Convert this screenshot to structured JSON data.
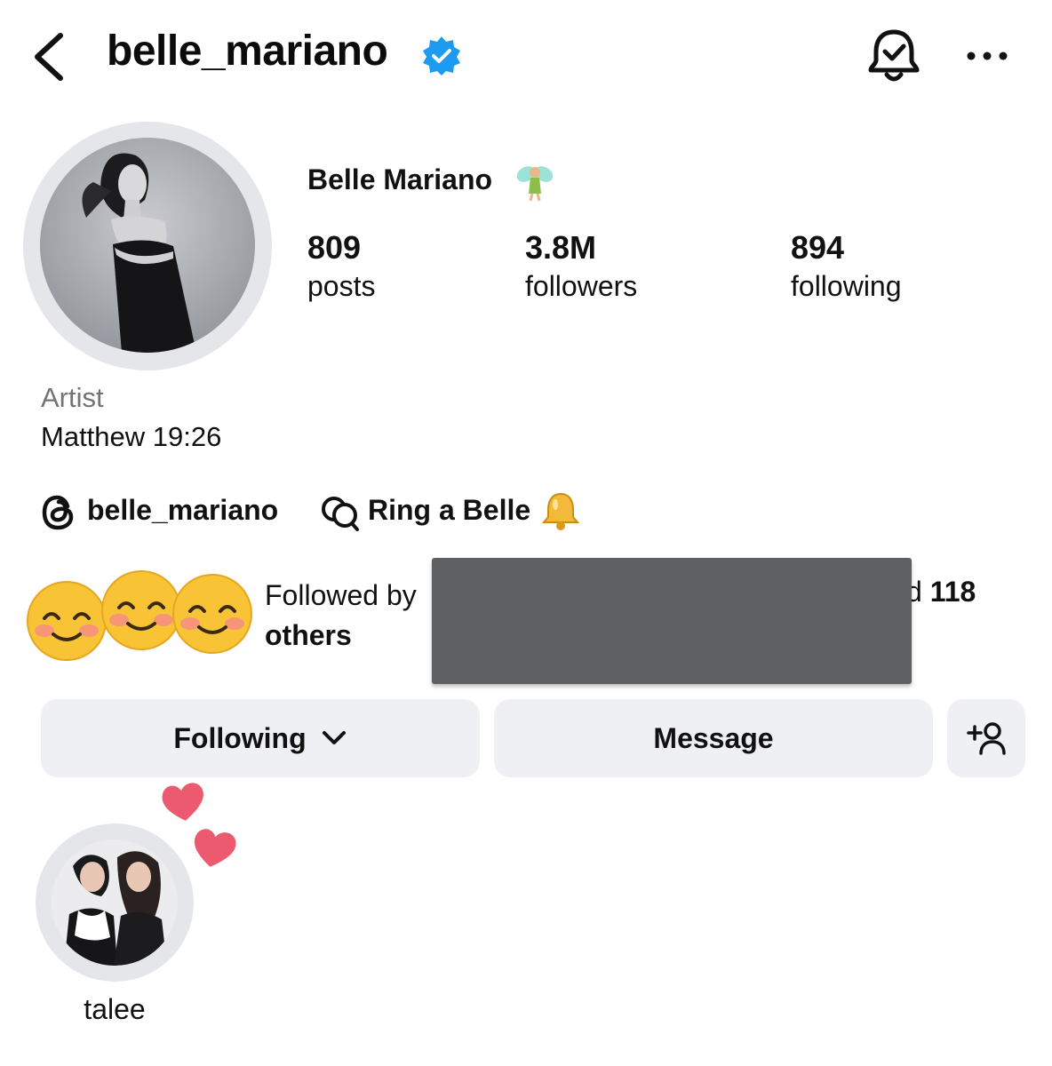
{
  "header": {
    "username": "belle_mariano",
    "back_icon": "chevron-left-icon",
    "verified_icon": "verified-badge-icon",
    "notifications_icon": "bell-check-icon",
    "more_icon": "more-horizontal-icon",
    "verified_color": "#1d9bf0"
  },
  "profile": {
    "full_name": "Belle Mariano",
    "name_emoji": "fairy-emoji",
    "stats": {
      "posts": {
        "value": "809",
        "label": "posts"
      },
      "followers": {
        "value": "3.8M",
        "label": "followers"
      },
      "following": {
        "value": "894",
        "label": "following"
      }
    },
    "category": "Artist",
    "bio": "Matthew 19:26"
  },
  "links": {
    "threads_handle": "belle_mariano",
    "channel_label": "Ring a Belle",
    "channel_emoji": "bell-emoji"
  },
  "followed_by": {
    "prefix": "Followed by",
    "suffix_visible": "d",
    "count": "118",
    "others": "others"
  },
  "actions": {
    "following_label": "Following",
    "message_label": "Message",
    "add_user_icon": "add-person-icon"
  },
  "highlights": [
    {
      "label": "talee"
    }
  ],
  "colors": {
    "button_bg": "#eef0f3",
    "ring": "#e4e6ea",
    "muted_text": "#737373",
    "heart": "#ec5a6f"
  }
}
